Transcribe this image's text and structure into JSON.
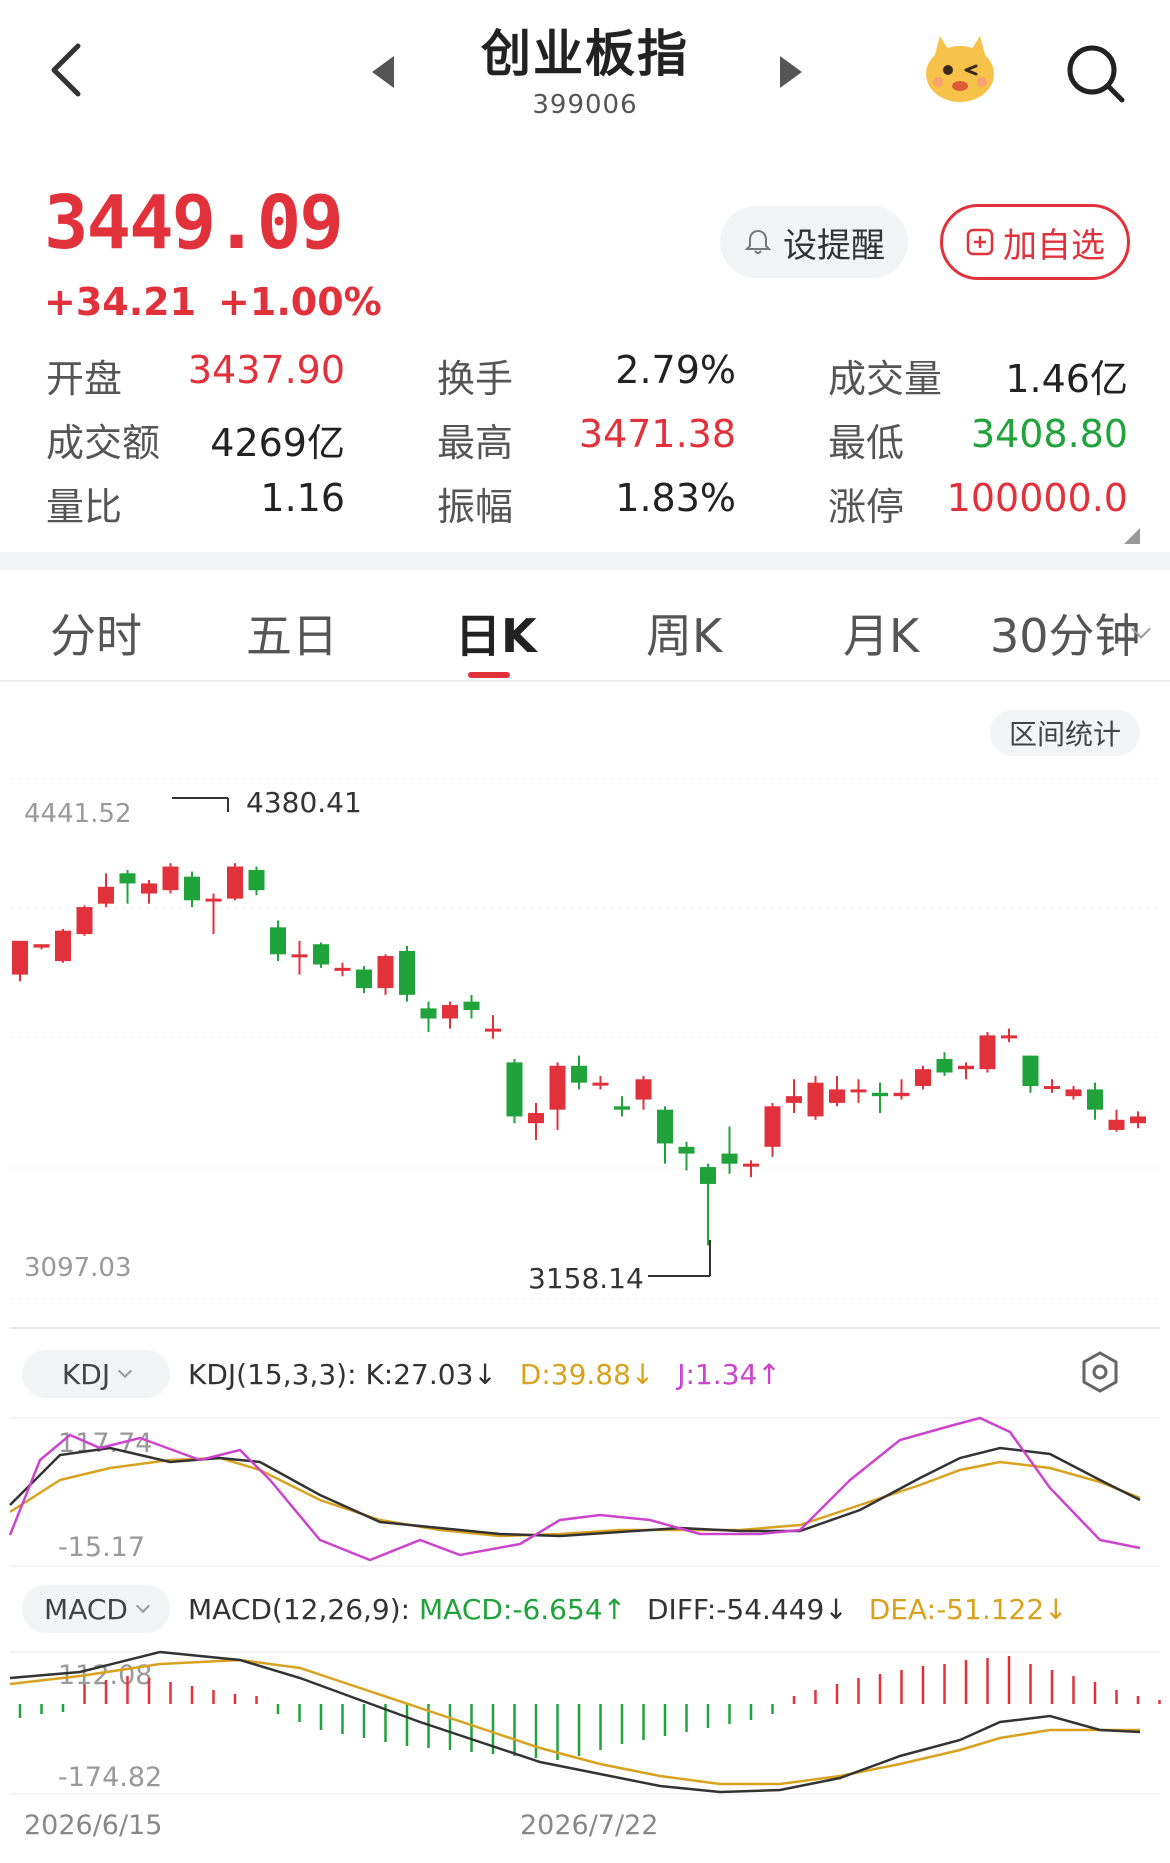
{
  "header": {
    "title": "创业板指",
    "code": "399006"
  },
  "quote": {
    "price": "3449.09",
    "change": "+34.21",
    "change_pct": "+1.00%",
    "alert_label": "设提醒",
    "add_label": "加自选"
  },
  "stats": [
    {
      "label": "开盘",
      "value": "3437.90",
      "color": "#e1323c"
    },
    {
      "label": "换手",
      "value": "2.79%",
      "color": "#222222"
    },
    {
      "label": "成交量",
      "value": "1.46亿",
      "color": "#222222"
    },
    {
      "label": "成交额",
      "value": "4269亿",
      "color": "#222222"
    },
    {
      "label": "最高",
      "value": "3471.38",
      "color": "#e1323c"
    },
    {
      "label": "最低",
      "value": "3408.80",
      "color": "#1fa33a"
    },
    {
      "label": "量比",
      "value": "1.16",
      "color": "#222222"
    },
    {
      "label": "振幅",
      "value": "1.83%",
      "color": "#222222"
    },
    {
      "label": "涨停",
      "value": "100000.0",
      "color": "#e1323c"
    }
  ],
  "tabs": [
    "分时",
    "五日",
    "日K",
    "周K",
    "月K",
    "30分钟"
  ],
  "active_tab": "日K",
  "range_stats_label": "区间统计",
  "colors": {
    "up": "#e1323c",
    "down": "#1fa33a",
    "k_line": "#333333",
    "d_line": "#d9a21e",
    "j_line": "#cc44cc"
  },
  "chart_data": {
    "type": "candlestick",
    "axis_labels": {
      "top": "4441.52",
      "bottom": "3097.03"
    },
    "annotations": {
      "high": "4380.41",
      "low": "3158.14"
    },
    "x_labels": [
      "2026/6/15",
      "2026/7/22"
    ],
    "candles": [
      [
        3960,
        4060,
        3970,
        3940,
        4010
      ],
      [
        4040,
        4050,
        4000,
        4035,
        4045
      ],
      [
        4000,
        4090,
        4080,
        3995,
        4095
      ],
      [
        4080,
        4160,
        4150,
        4075,
        4165
      ],
      [
        4170,
        4220,
        4200,
        4160,
        4260
      ],
      [
        4260,
        4230,
        4200,
        4170,
        4270
      ],
      [
        4200,
        4230,
        4185,
        4170,
        4240
      ],
      [
        4210,
        4280,
        4270,
        4200,
        4290
      ],
      [
        4250,
        4180,
        4170,
        4160,
        4265
      ],
      [
        4180,
        4185,
        4180,
        4080,
        4200
      ],
      [
        4185,
        4280,
        4275,
        4180,
        4290
      ],
      [
        4270,
        4210,
        4200,
        4195,
        4280
      ],
      [
        4100,
        4020,
        4010,
        4000,
        4120
      ],
      [
        4020,
        4020,
        4020,
        3960,
        4060
      ],
      [
        4050,
        3990,
        3985,
        3980,
        4055
      ],
      [
        3980,
        3980,
        3980,
        3955,
        3995
      ],
      [
        3975,
        3920,
        3920,
        3905,
        3985
      ],
      [
        3920,
        4015,
        4010,
        3900,
        4020
      ],
      [
        4030,
        3900,
        3890,
        3880,
        4045
      ],
      [
        3860,
        3830,
        3810,
        3790,
        3880
      ],
      [
        3830,
        3870,
        3870,
        3800,
        3880
      ],
      [
        3880,
        3855,
        3850,
        3830,
        3900
      ],
      [
        3800,
        3800,
        3800,
        3770,
        3840
      ],
      [
        3700,
        3540,
        3530,
        3520,
        3710
      ],
      [
        3520,
        3550,
        3560,
        3470,
        3580
      ],
      [
        3560,
        3690,
        3690,
        3500,
        3700
      ],
      [
        3690,
        3640,
        3640,
        3620,
        3720
      ],
      [
        3640,
        3640,
        3640,
        3620,
        3660
      ],
      [
        3570,
        3560,
        3560,
        3540,
        3600
      ],
      [
        3590,
        3650,
        3650,
        3560,
        3660
      ],
      [
        3560,
        3460,
        3450,
        3400,
        3570
      ],
      [
        3450,
        3430,
        3430,
        3380,
        3465
      ],
      [
        3390,
        3340,
        3340,
        3158,
        3400
      ],
      [
        3430,
        3400,
        3400,
        3370,
        3510
      ],
      [
        3400,
        3400,
        3400,
        3360,
        3410
      ],
      [
        3450,
        3570,
        3570,
        3420,
        3580
      ],
      [
        3580,
        3600,
        3600,
        3550,
        3650
      ],
      [
        3540,
        3640,
        3640,
        3530,
        3660
      ],
      [
        3580,
        3620,
        3620,
        3570,
        3660
      ],
      [
        3620,
        3620,
        3630,
        3580,
        3650
      ],
      [
        3610,
        3600,
        3600,
        3550,
        3640
      ],
      [
        3600,
        3610,
        3610,
        3590,
        3650
      ],
      [
        3630,
        3680,
        3680,
        3620,
        3690
      ],
      [
        3710,
        3670,
        3670,
        3660,
        3730
      ],
      [
        3680,
        3690,
        3690,
        3650,
        3700
      ],
      [
        3680,
        3780,
        3780,
        3670,
        3790
      ],
      [
        3780,
        3780,
        3780,
        3760,
        3800
      ],
      [
        3720,
        3630,
        3620,
        3610,
        3720
      ],
      [
        3630,
        3630,
        3630,
        3610,
        3650
      ],
      [
        3600,
        3620,
        3620,
        3590,
        3630
      ],
      [
        3620,
        3560,
        3560,
        3530,
        3640
      ],
      [
        3500,
        3530,
        3530,
        3495,
        3560
      ],
      [
        3520,
        3540,
        3540,
        3505,
        3555
      ]
    ]
  },
  "kdj": {
    "pill": "KDJ",
    "params": "KDJ(15,3,3):",
    "k": "K:27.03↓",
    "d": "D:39.88↓",
    "j": "J:1.34↑",
    "top": "117.74",
    "bottom": "-15.17"
  },
  "macd": {
    "pill": "MACD",
    "params": "MACD(12,26,9):",
    "macd": "MACD:-6.654↑",
    "diff": "DIFF:-54.449↓",
    "dea": "DEA:-51.122↓",
    "top": "112.08",
    "bottom": "-174.82"
  }
}
